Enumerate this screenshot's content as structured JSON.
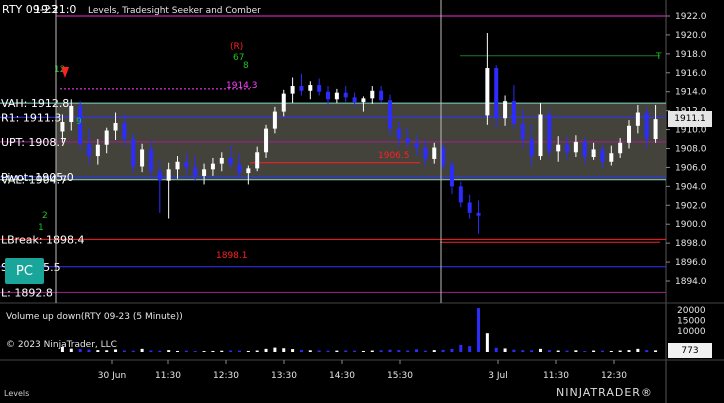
{
  "window": {
    "title_left": "RTY 09-23",
    "title_series": "19:21:0",
    "indicator_header": "Levels, Tradesight Seeker and Comber",
    "copyright": "© 2023 NinjaTrader, LLC",
    "footer_tab": "Levels",
    "pc_button": "PC",
    "brand": "NINJATRADER®"
  },
  "chart_data": {
    "type": "candlestick",
    "instrument": "RTY 09-23",
    "interval": "5 Minute",
    "x_tick_labels": [
      "30 Jun",
      "11:30",
      "12:30",
      "13:30",
      "14:30",
      "15:30",
      "3 Jul",
      "11:30",
      "12:30"
    ],
    "y_tick_labels": [
      "1922.0",
      "1920.0",
      "1918.0",
      "1916.0",
      "1914.0",
      "1912.0",
      "1910.0",
      "1908.0",
      "1906.0",
      "1904.0",
      "1902.0",
      "1900.0",
      "1898.0",
      "1896.0",
      "1894.0"
    ],
    "ylim": [
      1892.0,
      1923.0
    ],
    "last_price": "1911.1",
    "levels": [
      {
        "name": "VAH",
        "label": "VAH: 1912.8",
        "value": 1912.8,
        "color": "#ffffff"
      },
      {
        "name": "R1",
        "label": "R1: 1911.3",
        "value": 1911.3,
        "color": "#3232ff"
      },
      {
        "name": "UPT",
        "label": "UPT: 1908.7",
        "value": 1908.7,
        "color": "#a0208f"
      },
      {
        "name": "Pivot",
        "label": "Pivot: 1905.0",
        "value": 1905.0,
        "color": "#3232ff"
      },
      {
        "name": "VAL",
        "label": "VAL: 1904.7",
        "value": 1904.7,
        "color": "#ffffff"
      },
      {
        "name": "LBreak",
        "label": "LBreak: 1898.4",
        "value": 1898.4,
        "color": "#ff2020"
      },
      {
        "name": "S1",
        "label": "S1: 1895.5",
        "value": 1895.5,
        "color": "#3232ff"
      },
      {
        "name": "L",
        "label": "L: 1892.8",
        "value": 1892.8,
        "color": "#a0208f"
      }
    ],
    "annotations": [
      {
        "text": "1906.5",
        "color": "#ff2020"
      },
      {
        "text": "1898.1",
        "color": "#ff2020"
      },
      {
        "text": "1914.3",
        "color": "#ff44ff"
      },
      {
        "text": "(R)",
        "color": "#ff2020"
      },
      {
        "text": "67",
        "color": "#20c020"
      },
      {
        "text": "8",
        "color": "#20c020"
      },
      {
        "text": "12",
        "color": "#20c020"
      },
      {
        "text": "9",
        "color": "#20c020"
      },
      {
        "text": "2",
        "color": "#20c020"
      },
      {
        "text": "1",
        "color": "#20c020"
      },
      {
        "text": "T",
        "color": "#20c020"
      }
    ],
    "candles": [
      [
        1909.8,
        1911.6,
        1908.6,
        1910.8
      ],
      [
        1910.8,
        1913.2,
        1909.9,
        1912.5
      ],
      [
        1912.5,
        1913.0,
        1907.8,
        1908.5
      ],
      [
        1908.5,
        1910.1,
        1906.4,
        1907.2
      ],
      [
        1907.2,
        1909.0,
        1906.3,
        1908.4
      ],
      [
        1908.4,
        1910.2,
        1907.5,
        1909.9
      ],
      [
        1909.9,
        1911.8,
        1908.9,
        1910.7
      ],
      [
        1910.7,
        1911.6,
        1908.2,
        1909.0
      ],
      [
        1909.0,
        1909.6,
        1905.4,
        1906.1
      ],
      [
        1906.1,
        1908.5,
        1905.5,
        1907.9
      ],
      [
        1907.9,
        1908.8,
        1904.9,
        1905.6
      ],
      [
        1905.6,
        1906.7,
        1901.2,
        1904.6
      ],
      [
        1904.6,
        1906.5,
        1900.6,
        1905.8
      ],
      [
        1905.8,
        1907.2,
        1904.8,
        1906.6
      ],
      [
        1906.6,
        1907.5,
        1905.2,
        1906.0
      ],
      [
        1906.0,
        1907.2,
        1904.6,
        1905.1
      ],
      [
        1905.1,
        1906.4,
        1904.2,
        1905.8
      ],
      [
        1905.8,
        1907.0,
        1905.1,
        1906.4
      ],
      [
        1906.4,
        1907.6,
        1905.6,
        1907.0
      ],
      [
        1907.0,
        1908.3,
        1905.9,
        1906.3
      ],
      [
        1906.3,
        1907.5,
        1904.9,
        1905.4
      ],
      [
        1905.4,
        1906.2,
        1904.2,
        1905.9
      ],
      [
        1905.9,
        1908.2,
        1905.6,
        1907.6
      ],
      [
        1907.6,
        1910.5,
        1907.0,
        1910.1
      ],
      [
        1910.1,
        1912.4,
        1909.6,
        1911.9
      ],
      [
        1911.9,
        1914.2,
        1911.4,
        1913.8
      ],
      [
        1913.8,
        1915.5,
        1912.8,
        1914.6
      ],
      [
        1914.6,
        1915.9,
        1913.6,
        1914.1
      ],
      [
        1914.1,
        1915.1,
        1913.2,
        1914.7
      ],
      [
        1914.7,
        1915.4,
        1913.6,
        1914.0
      ],
      [
        1914.0,
        1914.6,
        1912.6,
        1913.2
      ],
      [
        1913.2,
        1914.3,
        1912.8,
        1913.9
      ],
      [
        1913.9,
        1914.6,
        1912.9,
        1913.4
      ],
      [
        1913.4,
        1913.9,
        1912.4,
        1912.9
      ],
      [
        1912.9,
        1913.5,
        1911.9,
        1913.3
      ],
      [
        1913.3,
        1914.6,
        1912.7,
        1914.1
      ],
      [
        1914.1,
        1914.6,
        1912.9,
        1913.1
      ],
      [
        1913.1,
        1913.7,
        1909.3,
        1910.1
      ],
      [
        1910.1,
        1910.8,
        1908.3,
        1909.1
      ],
      [
        1909.1,
        1910.2,
        1908.1,
        1908.6
      ],
      [
        1908.6,
        1909.4,
        1907.2,
        1908.1
      ],
      [
        1908.1,
        1908.9,
        1906.2,
        1906.9
      ],
      [
        1906.9,
        1908.6,
        1906.4,
        1908.1
      ],
      [
        1908.1,
        1908.5,
        1905.8,
        1906.2
      ],
      [
        1906.2,
        1906.8,
        1903.2,
        1904.0
      ],
      [
        1904.0,
        1904.5,
        1901.8,
        1902.3
      ],
      [
        1902.3,
        1903.1,
        1900.6,
        1901.2
      ],
      [
        1901.2,
        1902.5,
        1899.0,
        1900.9
      ],
      [
        1911.5,
        1920.2,
        1910.5,
        1916.5
      ],
      [
        1916.5,
        1916.8,
        1910.2,
        1911.2
      ],
      [
        1911.2,
        1913.6,
        1910.4,
        1913.0
      ],
      [
        1913.0,
        1914.7,
        1910.1,
        1910.6
      ],
      [
        1910.6,
        1912.2,
        1908.1,
        1909.0
      ],
      [
        1909.0,
        1910.6,
        1906.2,
        1907.2
      ],
      [
        1907.2,
        1912.8,
        1906.8,
        1911.6
      ],
      [
        1911.6,
        1912.1,
        1907.1,
        1907.7
      ],
      [
        1907.7,
        1909.3,
        1906.6,
        1908.4
      ],
      [
        1908.4,
        1909.2,
        1906.9,
        1907.6
      ],
      [
        1907.6,
        1909.4,
        1907.1,
        1908.7
      ],
      [
        1908.7,
        1909.2,
        1906.4,
        1907.1
      ],
      [
        1907.1,
        1908.6,
        1906.8,
        1907.9
      ],
      [
        1907.9,
        1908.4,
        1905.9,
        1906.6
      ],
      [
        1906.6,
        1908.3,
        1906.2,
        1907.5
      ],
      [
        1907.5,
        1909.1,
        1907.0,
        1908.6
      ],
      [
        1908.6,
        1911.0,
        1908.0,
        1910.4
      ],
      [
        1910.4,
        1912.6,
        1909.6,
        1911.8
      ],
      [
        1911.8,
        1912.3,
        1908.1,
        1909.0
      ],
      [
        1909.0,
        1912.6,
        1908.6,
        1911.1
      ]
    ],
    "volume_title": "Volume up down(RTY 09-23 (5 Minute))",
    "volume_y_tick_labels": [
      "20000",
      "15000",
      "10000"
    ],
    "volume_last": "773",
    "volume_ylim": [
      0,
      22000
    ],
    "volume": [
      2400,
      1600,
      1400,
      1100,
      900,
      800,
      1200,
      700,
      600,
      1500,
      700,
      600,
      900,
      500,
      600,
      500,
      450,
      500,
      600,
      700,
      650,
      500,
      700,
      1500,
      2100,
      1800,
      1400,
      900,
      800,
      700,
      600,
      650,
      700,
      600,
      500,
      700,
      800,
      1100,
      900,
      700,
      1300,
      600,
      900,
      1000,
      1500,
      3400,
      2800,
      21000,
      9000,
      2000,
      1700,
      1100,
      900,
      800,
      1500,
      900,
      700,
      650,
      800,
      500,
      700,
      600,
      500,
      700,
      900,
      1500,
      900,
      773
    ]
  }
}
